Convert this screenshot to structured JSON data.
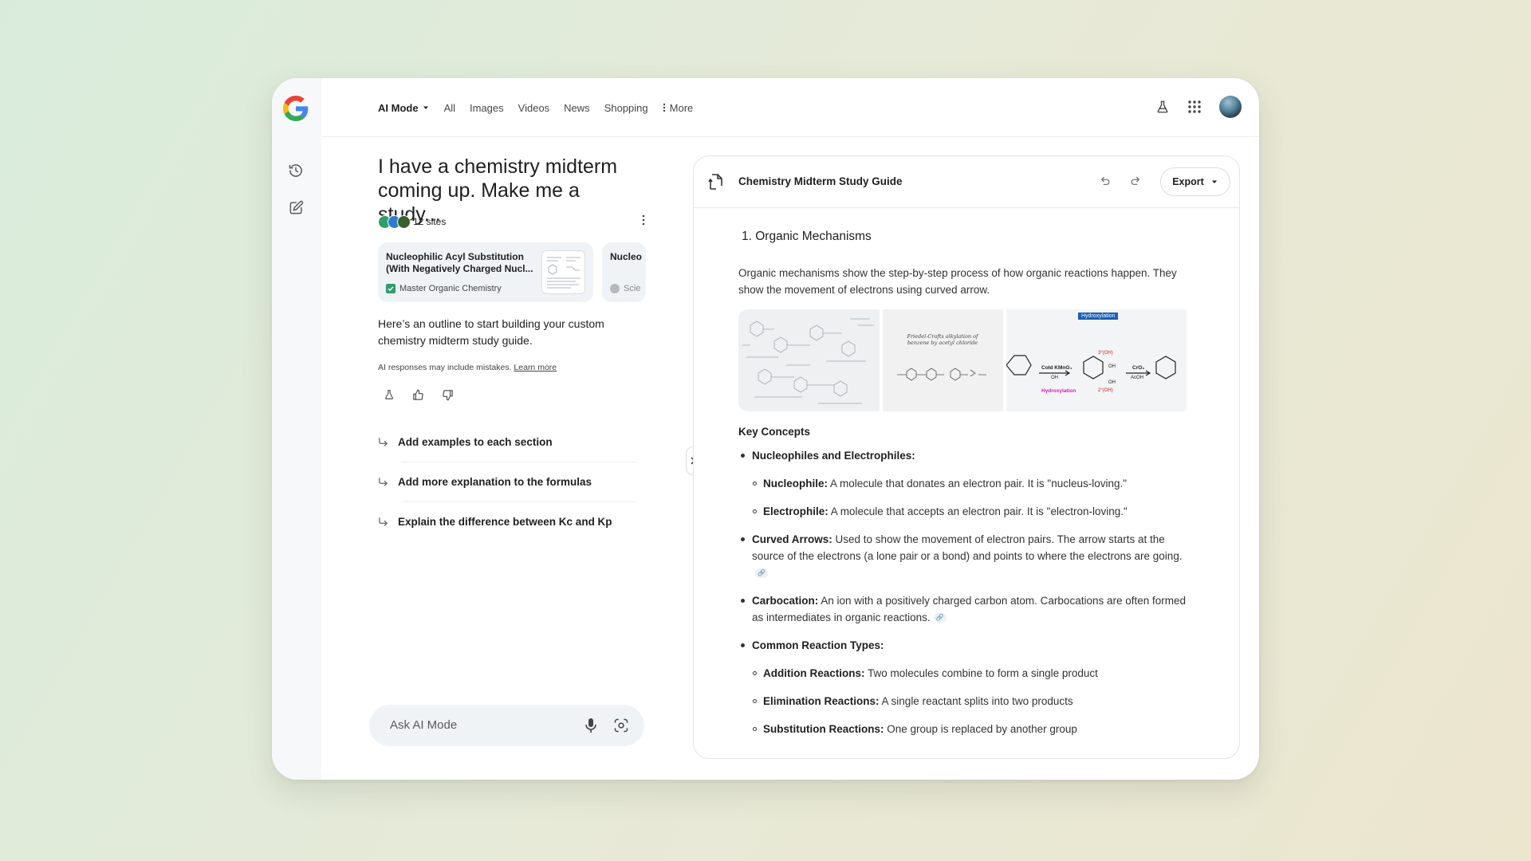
{
  "nav": {
    "tabs": [
      {
        "label": "AI Mode"
      },
      {
        "label": "All"
      },
      {
        "label": "Images"
      },
      {
        "label": "Videos"
      },
      {
        "label": "News"
      },
      {
        "label": "Shopping"
      },
      {
        "label": "More"
      }
    ]
  },
  "conversation": {
    "query": "I have a chemistry midterm coming up. Make me a study...",
    "sites_count": "12 sites",
    "sources": [
      {
        "title": "Nucleophilic Acyl Substitution (With Negatively Charged Nucl...",
        "site": "Master Organic Chemistry"
      },
      {
        "title": "Nucleo",
        "site": "Scie"
      }
    ],
    "response": "Here’s an outline to start building your custom chemistry midterm study guide.",
    "disclaimer": "AI responses may include mistakes.",
    "learn_more": "Learn more",
    "suggestions": [
      "Add examples to each section",
      "Add more explanation to the formulas",
      "Explain the difference between Kc and Kp"
    ],
    "ask_placeholder": "Ask AI Mode"
  },
  "doc": {
    "title": "Chemistry Midterm Study Guide",
    "export_label": "Export",
    "section_heading": "1.  Organic Mechanisms",
    "intro": "Organic mechanisms show the step-by-step process of how organic reactions happen. They show the movement of electrons using curved arrow.",
    "images": {
      "img3_label": "Hydroxylation",
      "img2_caption": "Friedel-Crafts alkylation of benzene by acetyl chloride",
      "img3_reagent1": "Cold KMnO₄",
      "img3_reagent1b": "OH",
      "img3_reagent2": "CrO₃",
      "img3_reagent2b": "AcOH",
      "img3_oh1": "3°(OH)",
      "img3_oh2": "2°(OH)",
      "img3_oh3": "OH",
      "img3_oh4": "OH",
      "img3_pink": "Hydroxylation"
    },
    "key_concepts": "Key Concepts",
    "items": {
      "nuc_elec": "Nucleophiles and Electrophiles:",
      "nucleophile_term": "Nucleophile:",
      "nucleophile_text": " A molecule that donates an electron pair. It is \"nucleus-loving.\"",
      "electrophile_term": "Electrophile:",
      "electrophile_text": " A molecule that accepts an electron pair. It is \"electron-loving.\"",
      "curved_term": "Curved Arrows:",
      "curved_text": " Used to show the movement of electron pairs. The arrow starts at the source of the electrons (a lone pair or a bond) and points to where the electrons are going.",
      "carbocation_term": "Carbocation:",
      "carbocation_text": "  An ion with a positively charged carbon atom. Carbocations are often formed as intermediates in organic reactions.",
      "reaction_types": "Common Reaction Types:",
      "addition_term": "Addition Reactions:",
      "addition_text": " Two molecules combine to form a single product",
      "elimination_term": "Elimination Reactions:",
      "elimination_text": " A single reactant splits into two products",
      "substitution_term": "Substitution Reactions:",
      "substitution_text": " One group is replaced by another group"
    }
  }
}
